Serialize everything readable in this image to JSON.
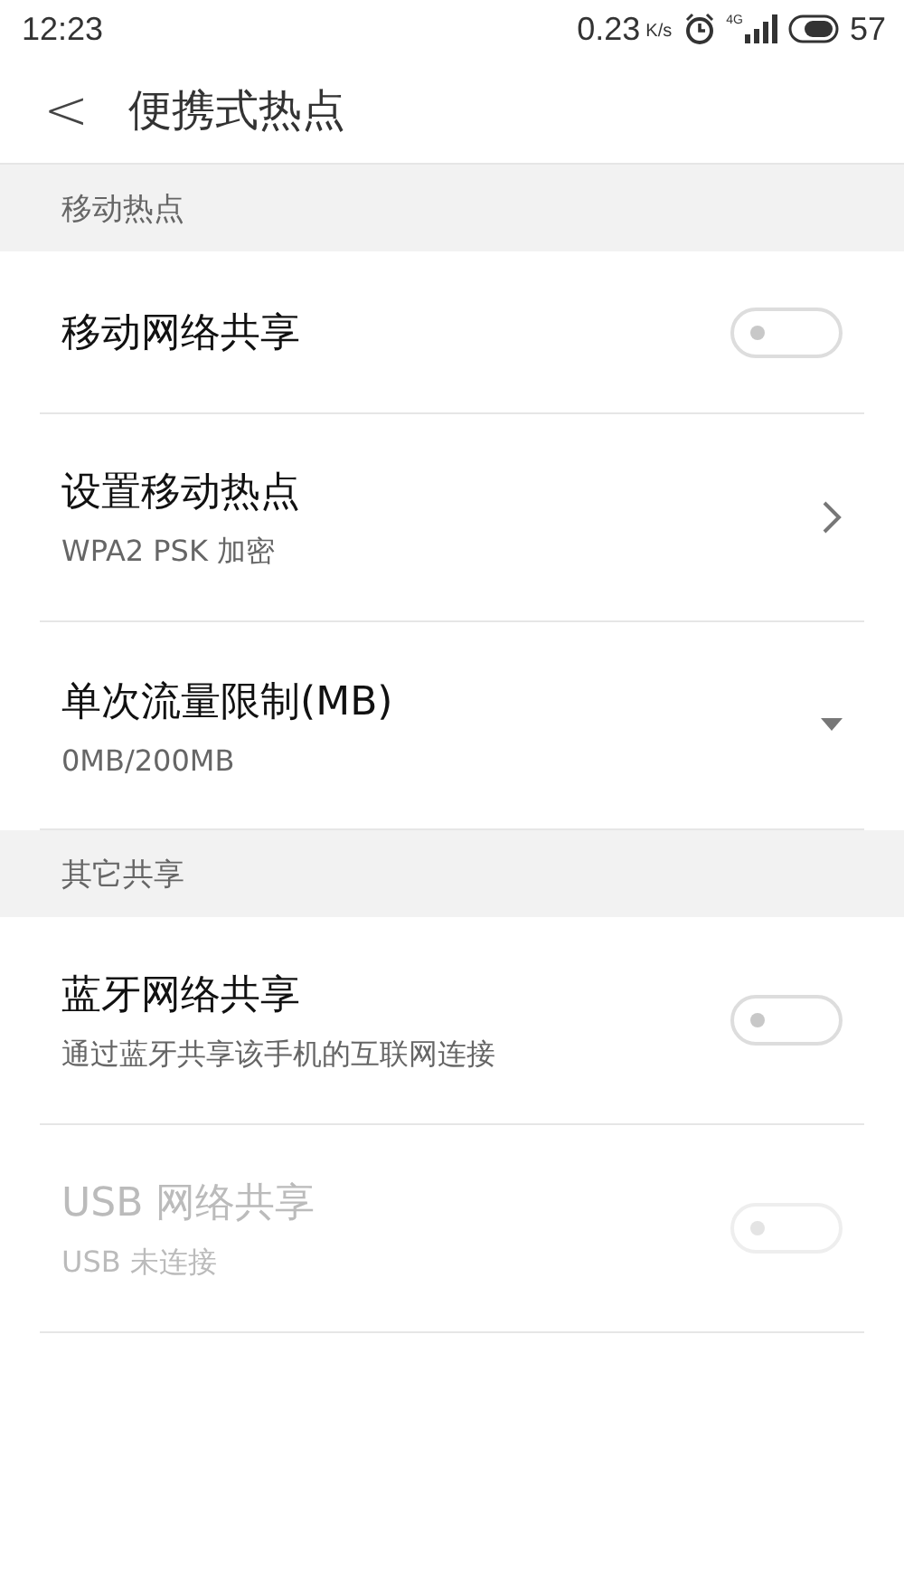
{
  "status_bar": {
    "time": "12:23",
    "speed": "0.23",
    "speed_unit": "K/s",
    "network": "4G",
    "battery": "57"
  },
  "header": {
    "back": "<",
    "title": "便携式热点"
  },
  "sections": [
    {
      "title": "移动热点",
      "items": [
        {
          "kind": "toggle",
          "label": "移动网络共享",
          "on": false,
          "disabled": false
        },
        {
          "kind": "link",
          "label": "设置移动热点",
          "summary": "WPA2 PSK 加密",
          "disabled": false
        },
        {
          "kind": "dropdown",
          "label": "单次流量限制(MB)",
          "summary": "0MB/200MB",
          "disabled": false
        }
      ]
    },
    {
      "title": "其它共享",
      "items": [
        {
          "kind": "toggle",
          "label": "蓝牙网络共享",
          "summary": "通过蓝牙共享该手机的互联网连接",
          "on": false,
          "disabled": false
        },
        {
          "kind": "toggle",
          "label": "USB 网络共享",
          "summary": "USB 未连接",
          "on": false,
          "disabled": true
        }
      ]
    }
  ]
}
